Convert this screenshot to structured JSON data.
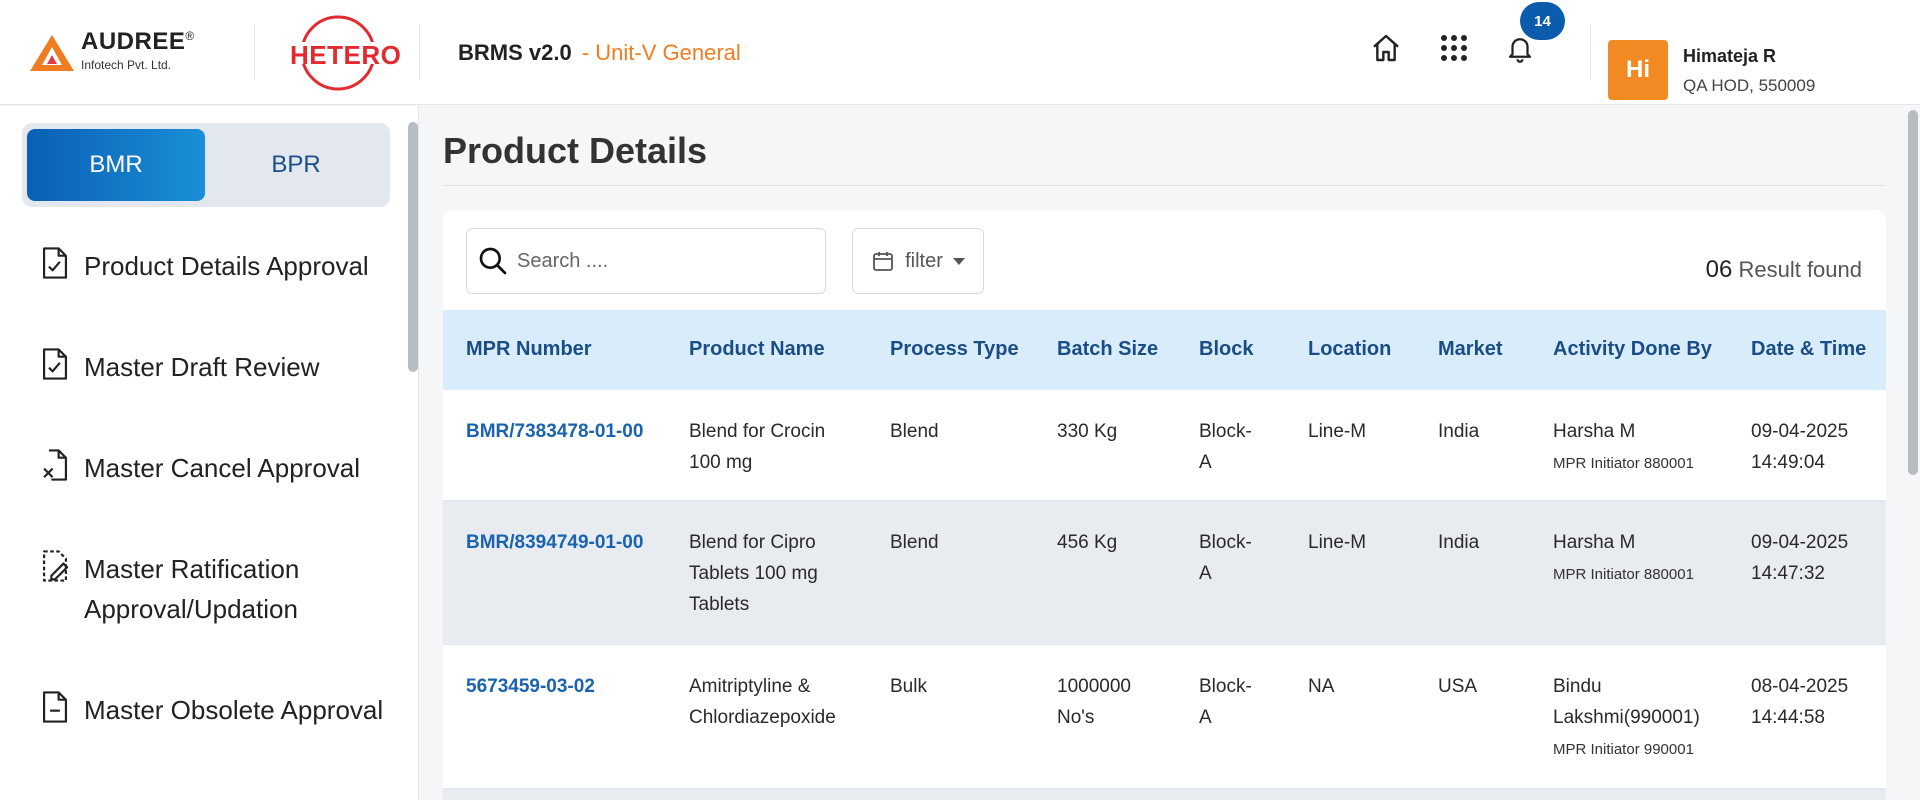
{
  "header": {
    "brand": {
      "name": "AUDREE",
      "reg": "®",
      "subtitle": "Infotech Pvt. Ltd."
    },
    "partner": {
      "name": "HETERO"
    },
    "app_name": "BRMS v2.0",
    "unit": "- Unit-V General",
    "notifications_count": "14",
    "user": {
      "initials": "Hi",
      "name": "Himateja R",
      "role": "QA HOD, 550009"
    },
    "icons": [
      "home-icon",
      "apps-grid-icon",
      "bell-icon"
    ]
  },
  "sidebar": {
    "tabs": [
      {
        "label": "BMR",
        "active": true
      },
      {
        "label": "BPR",
        "active": false
      }
    ],
    "items": [
      {
        "label": "Product Details Approval",
        "icon": "file-check-icon"
      },
      {
        "label": "Master Draft Review",
        "icon": "file-check-icon"
      },
      {
        "label": "Master Cancel Approval",
        "icon": "file-cancel-icon"
      },
      {
        "label": "Master Ratification Approval/Updation",
        "icon": "file-edit-icon"
      },
      {
        "label": "Master Obsolete Approval",
        "icon": "file-minus-icon"
      }
    ]
  },
  "main": {
    "title": "Product Details",
    "search": {
      "placeholder": "Search ...."
    },
    "filter": {
      "label": "filter"
    },
    "result": {
      "count": "06",
      "label": "Result found"
    },
    "table": {
      "columns": [
        "MPR Number",
        "Product Name",
        "Process Type",
        "Batch Size",
        "Block",
        "Location",
        "Market",
        "Activity Done By",
        "Date & Time"
      ],
      "rows": [
        {
          "mpr": "BMR/7383478-01-00",
          "product": "Blend for Crocin 100 mg",
          "process": "Blend",
          "batch": "330 Kg",
          "block": "Block-A",
          "location": "Line-M",
          "market": "India",
          "by": "Harsha M",
          "by_role": "MPR Initiator 880001",
          "date": "09-04-2025",
          "time": "14:49:04"
        },
        {
          "mpr": "BMR/8394749-01-00",
          "product": "Blend for Cipro Tablets 100 mg Tablets",
          "process": "Blend",
          "batch": "456 Kg",
          "block": "Block-A",
          "location": "Line-M",
          "market": "India",
          "by": "Harsha M",
          "by_role": "MPR Initiator 880001",
          "date": "09-04-2025",
          "time": "14:47:32"
        },
        {
          "mpr": "5673459-03-02",
          "product": "Amitriptyline & Chlordiazepoxide",
          "process": "Bulk",
          "batch": "1000000 No's",
          "block": "Block-A",
          "location": "NA",
          "market": "USA",
          "by": "Bindu Lakshmi(990001)",
          "by_role": "MPR Initiator 990001",
          "date": "08-04-2025",
          "time": "14:44:58"
        }
      ]
    }
  },
  "colors": {
    "accent": "#0b5cad",
    "brand_orange": "#f07c22",
    "header_row": "#d9ecfb",
    "link": "#1a63b0"
  }
}
